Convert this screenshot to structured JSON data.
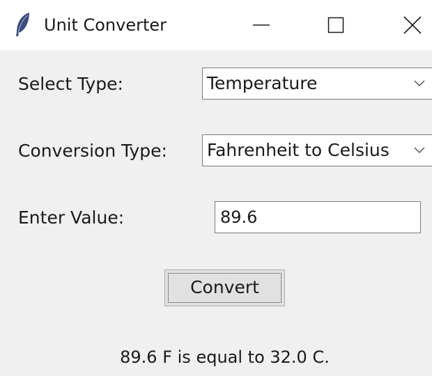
{
  "window": {
    "title": "Unit Converter",
    "icon": "feather-icon"
  },
  "form": {
    "select_type_label": "Select Type:",
    "select_type_value": "Temperature",
    "conversion_type_label": "Conversion Type:",
    "conversion_type_value": "Fahrenheit to Celsius",
    "enter_value_label": "Enter Value:",
    "enter_value": "89.6",
    "convert_label": "Convert"
  },
  "result": {
    "text": "89.6 F is equal to 32.0 C."
  },
  "colors": {
    "window_bg": "#f0f0f0",
    "titlebar_bg": "#ffffff",
    "button_bg": "#e1e1e1",
    "field_bg": "#ffffff"
  }
}
